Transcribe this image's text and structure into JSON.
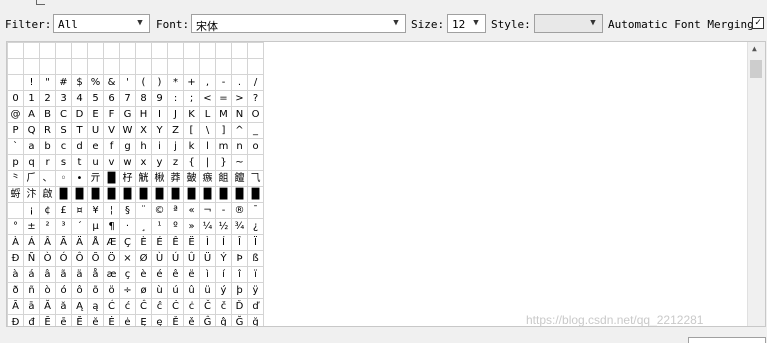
{
  "toolbar": {
    "filter_label": "Filter:",
    "filter_value": "All",
    "font_label": "Font:",
    "font_value": "宋体",
    "size_label": "Size:",
    "size_value": "12",
    "style_label": "Style:",
    "style_value": "",
    "merging_label": "Automatic Font Merging:",
    "merging_checked": true
  },
  "grid": {
    "rows": [
      [
        "",
        "",
        "",
        "",
        "",
        "",
        "",
        "",
        "",
        "",
        "",
        "",
        "",
        "",
        "",
        ""
      ],
      [
        "",
        "",
        "",
        "",
        "",
        "",
        "",
        "",
        "",
        "",
        "",
        "",
        "",
        "",
        "",
        ""
      ],
      [
        " ",
        "!",
        "\"",
        "#",
        "$",
        "%",
        "&",
        "'",
        "(",
        ")",
        "*",
        "+",
        ",",
        "-",
        ".",
        "/"
      ],
      [
        "0",
        "1",
        "2",
        "3",
        "4",
        "5",
        "6",
        "7",
        "8",
        "9",
        ":",
        ";",
        "<",
        "=",
        ">",
        "?"
      ],
      [
        "@",
        "A",
        "B",
        "C",
        "D",
        "E",
        "F",
        "G",
        "H",
        "I",
        "J",
        "K",
        "L",
        "M",
        "N",
        "O"
      ],
      [
        "P",
        "Q",
        "R",
        "S",
        "T",
        "U",
        "V",
        "W",
        "X",
        "Y",
        "Z",
        "[",
        "\\",
        "]",
        "^",
        "_"
      ],
      [
        "`",
        "a",
        "b",
        "c",
        "d",
        "e",
        "f",
        "g",
        "h",
        "i",
        "j",
        "k",
        "l",
        "m",
        "n",
        "o"
      ],
      [
        "p",
        "q",
        "r",
        "s",
        "t",
        "u",
        "v",
        "w",
        "x",
        "y",
        "z",
        "{",
        "|",
        "}",
        "~",
        ""
      ],
      [
        "⺀",
        "⺁",
        "、",
        "◦",
        "•",
        "亓",
        "█",
        "杍",
        "觥",
        "楸",
        "莽",
        "皷",
        "瘯",
        "飷",
        "饘",
        "⺄"
      ],
      [
        "蛶",
        "汴",
        "啟",
        "█",
        "█",
        "█",
        "█",
        "█",
        "█",
        "█",
        "█",
        "█",
        "█",
        "█",
        "█",
        "█"
      ],
      [
        "",
        "¡",
        "¢",
        "£",
        "¤",
        "¥",
        "¦",
        "§",
        "¨",
        "©",
        "ª",
        "«",
        "¬",
        "-",
        "®",
        "¯"
      ],
      [
        "°",
        "±",
        "²",
        "³",
        "´",
        "µ",
        "¶",
        "·",
        "¸",
        "¹",
        "º",
        "»",
        "¼",
        "½",
        "¾",
        "¿"
      ],
      [
        "À",
        "Á",
        "Â",
        "Ã",
        "Ä",
        "Å",
        "Æ",
        "Ç",
        "È",
        "É",
        "Ê",
        "Ë",
        "Ì",
        "Í",
        "Î",
        "Ï"
      ],
      [
        "Ð",
        "Ñ",
        "Ò",
        "Ó",
        "Ô",
        "Õ",
        "Ö",
        "×",
        "Ø",
        "Ù",
        "Ú",
        "Û",
        "Ü",
        "Ý",
        "Þ",
        "ß"
      ],
      [
        "à",
        "á",
        "â",
        "ã",
        "ä",
        "å",
        "æ",
        "ç",
        "è",
        "é",
        "ê",
        "ë",
        "ì",
        "í",
        "î",
        "ï"
      ],
      [
        "ð",
        "ñ",
        "ò",
        "ó",
        "ô",
        "õ",
        "ö",
        "÷",
        "ø",
        "ù",
        "ú",
        "û",
        "ü",
        "ý",
        "þ",
        "ÿ"
      ],
      [
        "Ā",
        "ā",
        "Ă",
        "ă",
        "Ą",
        "ą",
        "Ć",
        "ć",
        "Ĉ",
        "ĉ",
        "Ċ",
        "ċ",
        "Č",
        "č",
        "Ď",
        "ď"
      ],
      [
        "Đ",
        "đ",
        "Ē",
        "ē",
        "Ĕ",
        "ĕ",
        "Ė",
        "ė",
        "Ę",
        "ę",
        "Ě",
        "ě",
        "Ĝ",
        "ĝ",
        "Ğ",
        "ğ"
      ]
    ]
  },
  "watermark": "https://blog.csdn.net/qq_2212281"
}
